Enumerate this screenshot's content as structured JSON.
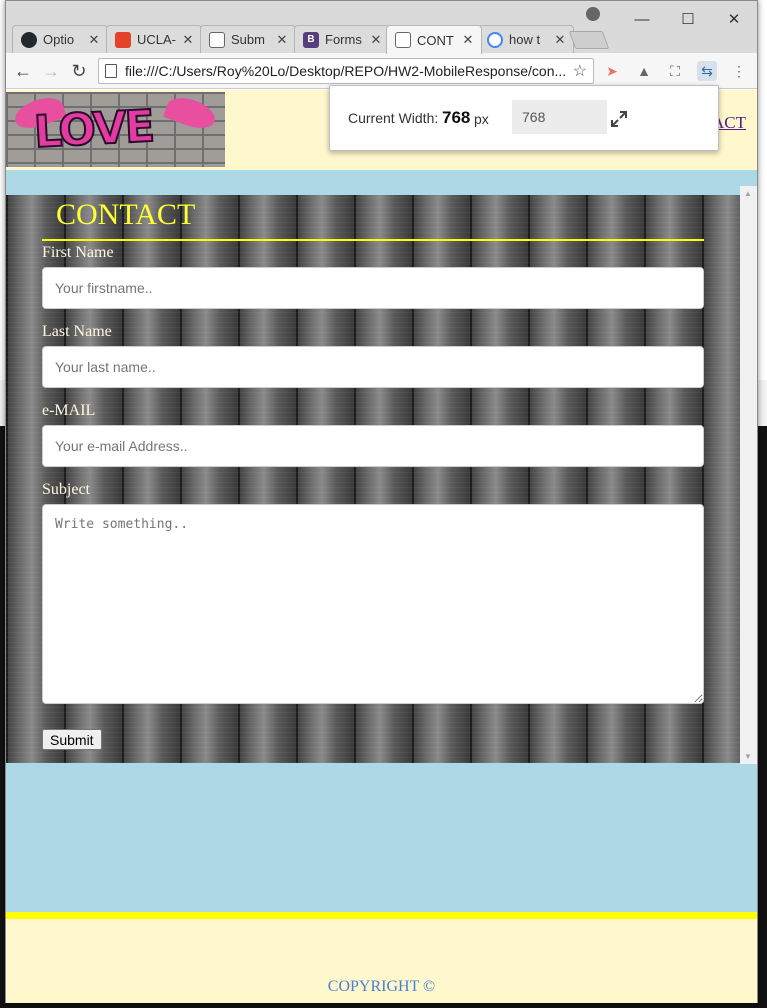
{
  "browser": {
    "tabs": [
      {
        "label": "Optio",
        "icon": "github-icon",
        "active": false
      },
      {
        "label": "UCLA-",
        "icon": "gitlab-icon",
        "active": false
      },
      {
        "label": "Subm",
        "icon": "page-icon",
        "active": false
      },
      {
        "label": "Forms",
        "icon": "bootstrap-icon",
        "active": false
      },
      {
        "label": "CONT",
        "icon": "page-icon",
        "active": true
      },
      {
        "label": "how t",
        "icon": "google-icon",
        "active": false
      }
    ],
    "url": "file:///C:/Users/Roy%20Lo/Desktop/REPO/HW2-MobileResponse/con..."
  },
  "extension_popup": {
    "label": "Current Width:",
    "value": "768",
    "unit": "px",
    "input_value": "768"
  },
  "site": {
    "logo_text": "LOVE",
    "nav_link": "ACT",
    "contact_title": "CONTACT",
    "form": {
      "first_name_label": "First Name",
      "first_name_placeholder": "Your firstname..",
      "last_name_label": "Last Name",
      "last_name_placeholder": "Your last name..",
      "email_label": "e-MAIL",
      "email_placeholder": "Your e-mail Address..",
      "subject_label": "Subject",
      "subject_placeholder": "Write something..",
      "submit_label": "Submit"
    },
    "copyright": "COPYRIGHT ©"
  },
  "colors": {
    "header_bg": "#fff8cc",
    "page_bg": "#add8e6",
    "accent_yellow": "#ffff00",
    "copyright_blue": "#4a7fd6"
  }
}
